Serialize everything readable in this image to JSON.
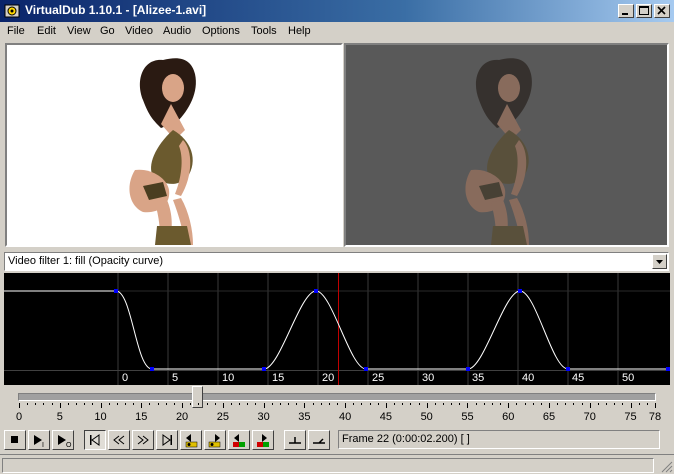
{
  "window": {
    "title": "VirtualDub 1.10.1 - [Alizee-1.avi]",
    "controls": {
      "minimize": "minimize-icon",
      "maximize": "maximize-icon",
      "close": "close-icon"
    }
  },
  "menu": [
    "File",
    "Edit",
    "View",
    "Go",
    "Video",
    "Audio",
    "Options",
    "Tools",
    "Help"
  ],
  "filter_select": {
    "selected": "Video filter 1: fill (Opacity curve)"
  },
  "curve_editor": {
    "scale_labels": [
      "0",
      "5",
      "10",
      "15",
      "20",
      "25",
      "30",
      "35",
      "40",
      "45",
      "50"
    ],
    "colors": {
      "background": "#000000",
      "curve": "#ffffff",
      "points": "#0000ff",
      "cursor": "#c00000"
    }
  },
  "timeline": {
    "tick_labels": [
      "0",
      "5",
      "10",
      "15",
      "20",
      "25",
      "30",
      "35",
      "40",
      "45",
      "50",
      "55",
      "60",
      "65",
      "70",
      "75",
      "78"
    ],
    "current_frame": 22,
    "total_frames": 78
  },
  "toolbar": {
    "buttons": [
      "stop-icon",
      "play-input-icon",
      "play-output-icon",
      "start-icon",
      "prev-frame-icon",
      "next-frame-icon",
      "end-icon",
      "prev-keyframe-icon",
      "next-keyframe-icon",
      "prev-scene-icon",
      "next-scene-icon",
      "mark-in-icon",
      "mark-out-icon"
    ],
    "frame_readout": "Frame 22 (0:00:02.200) [ ]"
  }
}
